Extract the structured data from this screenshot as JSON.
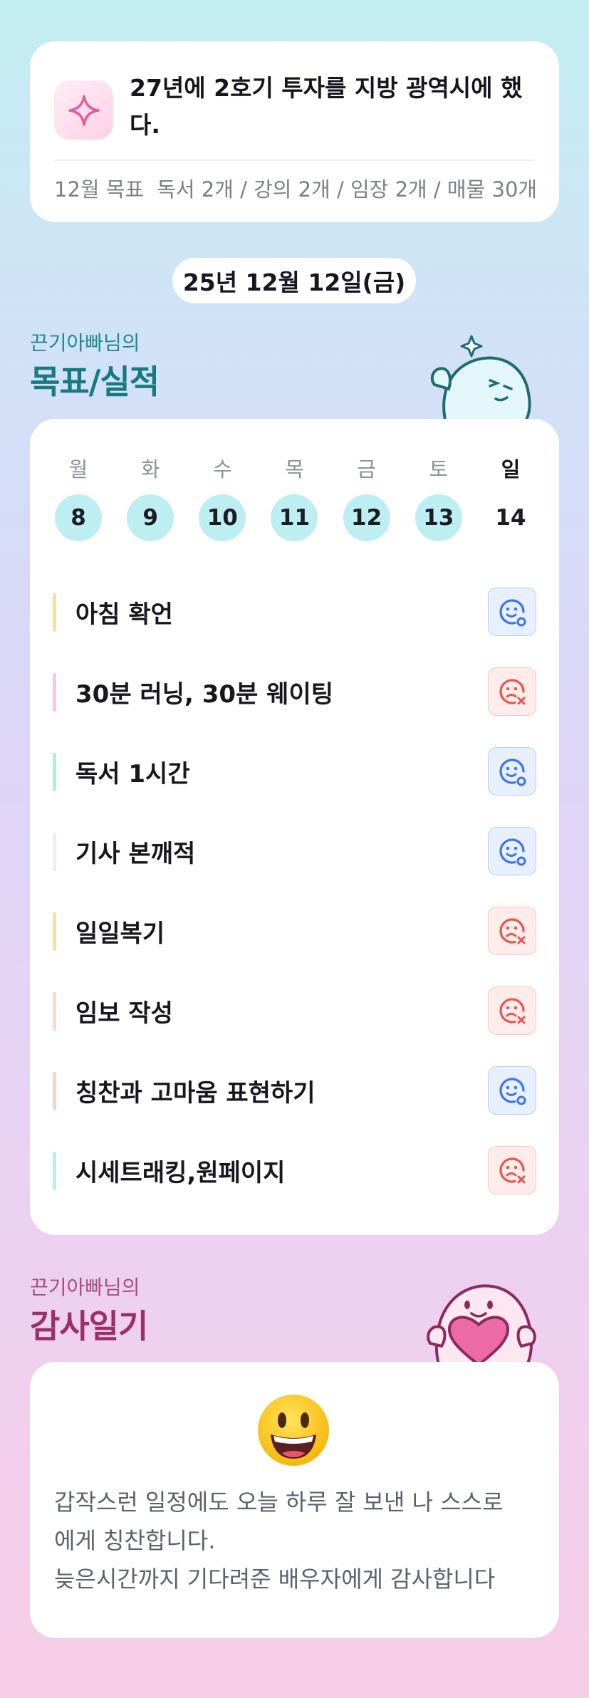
{
  "goal": {
    "text": "27년에 2호기 투자를 지방 광역시에 했다.",
    "target_label": "12월 목표",
    "target_value": "독서 2개 / 강의 2개 / 임장 2개 / 매물 30개",
    "icon": "sparkle-icon"
  },
  "date": "25년 12월 12일(금)",
  "results_section": {
    "subtitle": "끈기아빠님의",
    "title": "목표/실적"
  },
  "week": {
    "days": [
      "월",
      "화",
      "수",
      "목",
      "금",
      "토",
      "일"
    ],
    "dates": [
      "8",
      "9",
      "10",
      "11",
      "12",
      "13",
      "14"
    ],
    "done_flags": [
      true,
      true,
      true,
      true,
      true,
      true,
      false
    ]
  },
  "tasks": [
    {
      "name": "아침 확언",
      "status": "success",
      "bar_color": "#f8dea6"
    },
    {
      "name": "30분 러닝, 30분 웨이팅",
      "status": "fail",
      "bar_color": "#f8c8e0"
    },
    {
      "name": "독서 1시간",
      "status": "success",
      "bar_color": "#b4ecd8"
    },
    {
      "name": "기사 본깨적",
      "status": "success",
      "bar_color": "#eeeff2"
    },
    {
      "name": "일일복기",
      "status": "fail",
      "bar_color": "#f8dea6"
    },
    {
      "name": "임보 작성",
      "status": "fail",
      "bar_color": "#fbd6d0"
    },
    {
      "name": "칭찬과 고마움 표현하기",
      "status": "success",
      "bar_color": "#fbd0d0"
    },
    {
      "name": "시세트래킹,원페이지",
      "status": "fail",
      "bar_color": "#bde9f0"
    }
  ],
  "gratitude_section": {
    "subtitle": "끈기아빠님의",
    "title": "감사일기"
  },
  "gratitude": {
    "emoji": "grinning-face-icon",
    "lines": [
      "갑작스런 일정에도 오늘 하루 잘 보낸 나 스스로",
      "에게 칭찬합니다.",
      "늦은시간까지 기다려준 배우자에게 감사합니다"
    ]
  },
  "colors": {
    "results_title": "#167a80",
    "results_subtitle": "#1f8a8f",
    "gratitude_title": "#9b2e6b",
    "gratitude_subtitle": "#a64d80",
    "success_icon": "#3e73f0",
    "fail_icon": "#e8554b"
  }
}
